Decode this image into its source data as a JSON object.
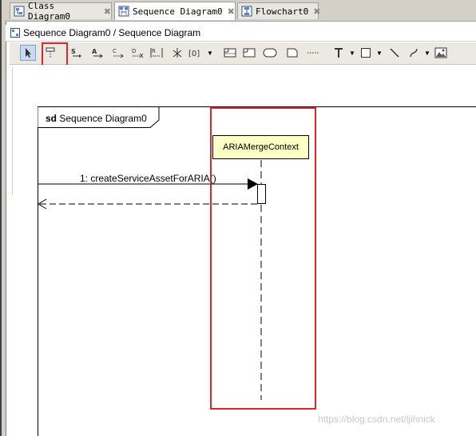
{
  "tabs": [
    {
      "label": "Class Diagram0",
      "icon": "class-diagram-icon",
      "close": "✖"
    },
    {
      "label": "Sequence Diagram0",
      "icon": "sequence-diagram-icon",
      "close": "✖",
      "active": true
    },
    {
      "label": "Flowchart0",
      "icon": "flowchart-icon",
      "close": "✖"
    }
  ],
  "title": {
    "text": "Sequence Diagram0 / Sequence Diagram",
    "icon": "diagram-icon"
  },
  "toolbar": {
    "tools": [
      "select-arrow-icon",
      "lifeline-tool-icon",
      "sync-message-icon",
      "async-message-icon",
      "create-message-icon",
      "destroy-message-icon",
      "reply-message-icon",
      "lost-message-icon",
      "found-message-icon",
      "combined-fragment-icon",
      "interaction-use-icon",
      "state-invariant-icon",
      "comment-icon",
      "dashed-line-icon",
      "text-icon",
      "rectangle-icon",
      "line-icon",
      "curve-icon",
      "image-icon"
    ],
    "highlight_color": "#e0242a"
  },
  "diagram": {
    "frame": {
      "keyword": "sd",
      "name": "Sequence Diagram0"
    },
    "lifeline": {
      "name": "ARIAMergeContext",
      "fill": "#ffffc6"
    },
    "message": {
      "label": "1: createServiceAssetForARIA()"
    }
  },
  "watermark": "https://blog.csdn.net/ljihnick"
}
